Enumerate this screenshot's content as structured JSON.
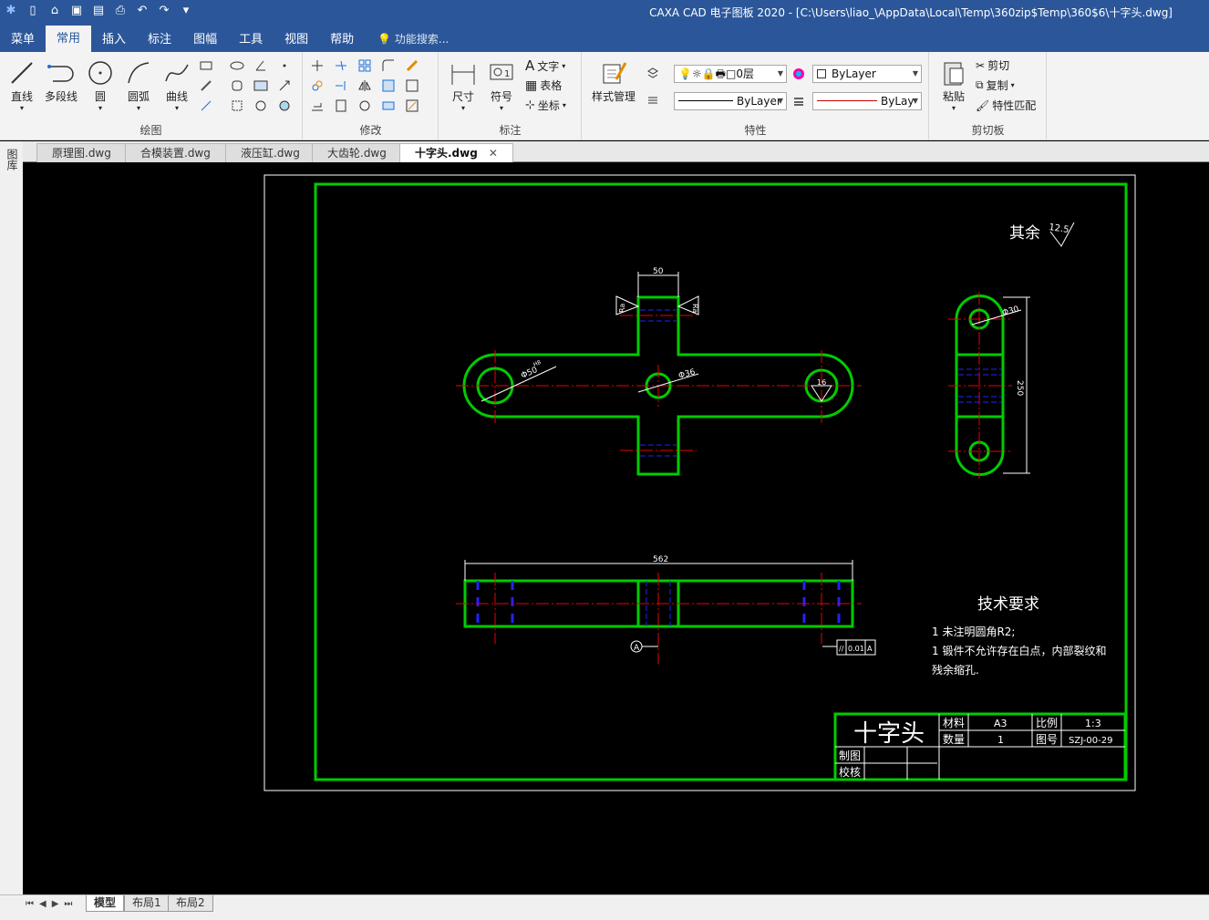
{
  "titlebar": {
    "title": "CAXA CAD 电子图板 2020 - [C:\\Users\\liao_\\AppData\\Local\\Temp\\360zip$Temp\\360$6\\十字头.dwg]"
  },
  "menubar": {
    "items": [
      "菜单",
      "常用",
      "插入",
      "标注",
      "图幅",
      "工具",
      "视图",
      "帮助"
    ],
    "active": "常用",
    "search_label": "功能搜索..."
  },
  "ribbon": {
    "draw": {
      "label": "绘图",
      "line": "直线",
      "polyline": "多段线",
      "circle": "圆",
      "arc": "圆弧",
      "curve": "曲线"
    },
    "modify": {
      "label": "修改"
    },
    "annotate": {
      "label": "标注",
      "dimension": "尺寸",
      "symbol": "符号",
      "text": "文字",
      "table": "表格",
      "coord": "坐标"
    },
    "properties": {
      "label": "特性",
      "style_mgr": "样式管理",
      "layer": "0层",
      "color": "ByLayer",
      "linetype": "ByLayer",
      "lineweight": "ByLay"
    },
    "clipboard": {
      "label": "剪切板",
      "paste": "粘贴",
      "cut": "剪切",
      "copy": "复制",
      "match": "特性匹配"
    }
  },
  "sidebar": {
    "label": "图库"
  },
  "doc_tabs": [
    "原理图.dwg",
    "合模装置.dwg",
    "液压缸.dwg",
    "大齿轮.dwg",
    "十字头.dwg"
  ],
  "active_doc": "十字头.dwg",
  "layout_tabs": [
    "模型",
    "布局1",
    "布局2"
  ],
  "drawing": {
    "roughness_prefix": "其余",
    "roughness_value": "12.5",
    "dims": {
      "top_width": "50",
      "hole_big": "Φ50",
      "hole_big_fit": "H8",
      "hole_center": "Φ36",
      "hole_right": "16",
      "side_hole": "Φ30",
      "side_height": "250",
      "total_length": "562",
      "datum": "A",
      "tolerance_sym": "//",
      "tolerance_val": "0.01",
      "tolerance_ref": "A",
      "left_tol": "Ra",
      "right_tol": "Ra"
    },
    "tech_req": {
      "title": "技术要求",
      "line1": "1 未注明圆角R2;",
      "line2": "1 锻件不允许存在白点，内部裂纹和",
      "line3": "残余缩孔."
    },
    "titleblock": {
      "name": "十字头",
      "material_label": "材料",
      "material": "A3",
      "scale_label": "比例",
      "scale": "1:3",
      "qty_label": "数量",
      "qty": "1",
      "drawing_no_label": "图号",
      "drawing_no": "SZJ-00-29",
      "drawn_label": "制图",
      "checked_label": "校核"
    }
  }
}
